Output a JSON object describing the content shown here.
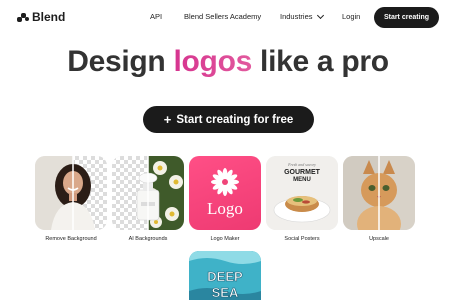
{
  "nav": {
    "brand": "Blend",
    "links": [
      "API",
      "Blend Sellers Academy",
      "Industries",
      "Login"
    ],
    "cta": "Start creating"
  },
  "hero": {
    "title_before": "Design ",
    "title_accent": "logos",
    "title_after": " like a pro",
    "cta_icon": "+",
    "cta_label": "Start creating for free"
  },
  "colors": {
    "accent": "#d6348f",
    "dark": "#1b1b1b",
    "logo_tile": "#f04579"
  },
  "cards": [
    {
      "label": "Remove Background",
      "icon": "portrait-image"
    },
    {
      "label": "AI Backgrounds",
      "icon": "product-image"
    },
    {
      "label": "Logo Maker",
      "icon": "flower-logo",
      "logo_text": "Logo"
    },
    {
      "label": "Social Posters",
      "icon": "food-poster",
      "poster_small": "Fresh and savory",
      "poster_title": "GOURMET MENU"
    },
    {
      "label": "Upscale",
      "icon": "cat-image"
    },
    {
      "label": "",
      "icon": "ocean-poster",
      "poster_title": "DEEP SEA"
    }
  ]
}
